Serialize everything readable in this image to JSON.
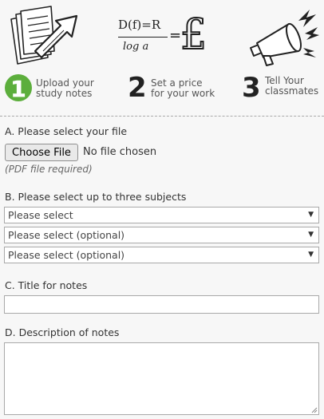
{
  "steps": [
    {
      "number": "1",
      "line1": "Upload your",
      "line2": "study notes",
      "illustration": "document-upload-icon"
    },
    {
      "number": "2",
      "line1": "Set a price",
      "line2": "for your work",
      "illustration": "formula-pound-icon",
      "formula_top": "D(f)=R",
      "formula_bottom": "log a",
      "currency": "£"
    },
    {
      "number": "3",
      "line1": "Tell Your",
      "line2": "classmates",
      "illustration": "megaphone-icon"
    }
  ],
  "colors": {
    "accent_green": "#5cae3c",
    "dark": "#333333",
    "background": "#f7f7f7"
  },
  "form": {
    "file_section": {
      "label": "A. Please select your file",
      "button_label": "Choose File",
      "status": "No file chosen",
      "hint": "(PDF file required)"
    },
    "subjects_section": {
      "label": "B. Please select up to three subjects",
      "selects": [
        {
          "value": "Please select"
        },
        {
          "value": "Please select (optional)"
        },
        {
          "value": "Please select (optional)"
        }
      ]
    },
    "title_section": {
      "label": "C. Title for notes",
      "value": ""
    },
    "description_section": {
      "label": "D. Description of notes",
      "value": ""
    }
  }
}
